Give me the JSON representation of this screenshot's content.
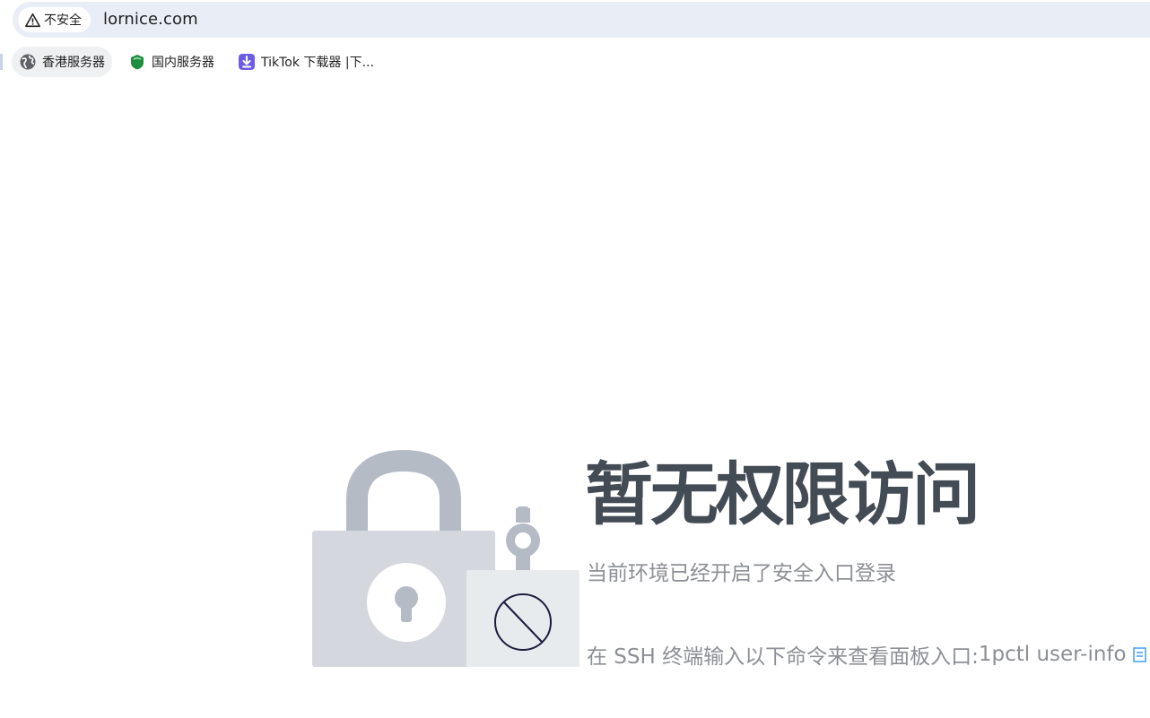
{
  "browser": {
    "security_label": "不安全",
    "url": "lornice.com",
    "bookmarks": [
      {
        "label": "香港服务器",
        "icon": "globe-icon"
      },
      {
        "label": "国内服务器",
        "icon": "green-shield-icon"
      },
      {
        "label": "TikTok 下载器 |下...",
        "icon": "download-icon"
      }
    ]
  },
  "main": {
    "title": "暂无权限访问",
    "subtitle": "当前环境已经开启了安全入口登录",
    "command_prefix": "在 SSH 终端输入以下命令来查看面板入口: ",
    "command": "1pctl user-info"
  },
  "colors": {
    "title": "#434b55",
    "text": "#8c8f94",
    "lock_gray": "#b4bbc5",
    "lock_body": "#d4d8de",
    "accent_blue": "#409eff"
  }
}
